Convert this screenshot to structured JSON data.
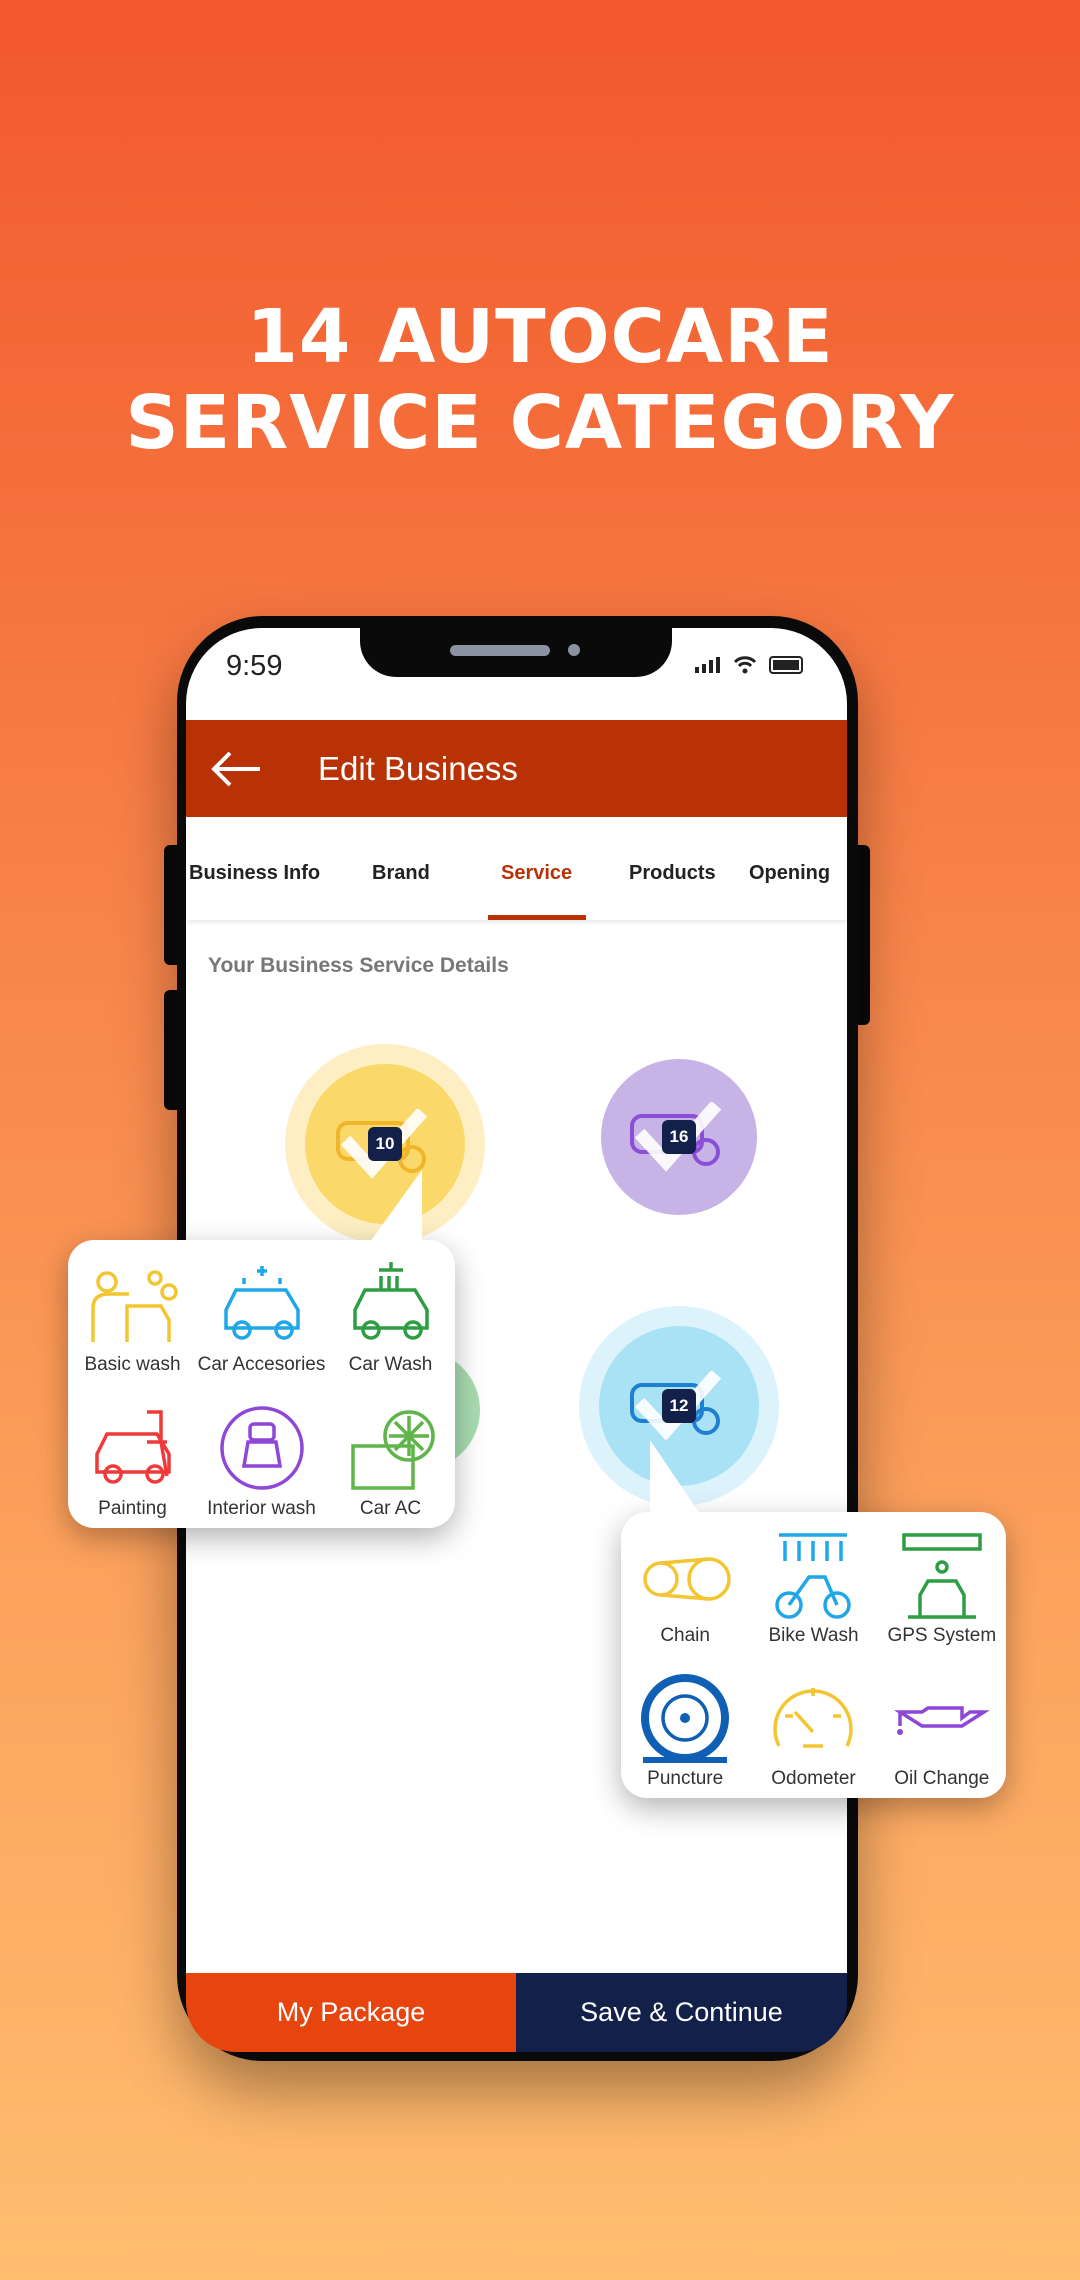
{
  "headline": {
    "line1": "14 AUTOCARE",
    "line2": "SERVICE CATEGORY"
  },
  "status_bar": {
    "time": "9:59",
    "icons": [
      "signal-icon",
      "wifi-icon",
      "battery-icon"
    ]
  },
  "header": {
    "title": "Edit Business",
    "back_icon": "arrow-left-icon"
  },
  "tabs": [
    {
      "label": "Business Info"
    },
    {
      "label": "Brand"
    },
    {
      "label": "Service",
      "active": true
    },
    {
      "label": "Products"
    },
    {
      "label": "Opening"
    }
  ],
  "section_title": "Your Business Service Details",
  "categories": [
    {
      "icon": "car-icon",
      "badge": "10",
      "color": "#fbd86a"
    },
    {
      "icon": "truck-icon",
      "badge": "16",
      "color": "#c8b3e6"
    },
    {
      "icon": "motorbike-icon",
      "badge": "12",
      "color": "#a9e2f5"
    },
    {
      "icon": "green-category-icon",
      "color": "#a9dcb0"
    }
  ],
  "popup_car": [
    {
      "label": "Basic wash",
      "icon": "person-washing-car-icon",
      "color": "#f3c531"
    },
    {
      "label": "Car Accesories",
      "icon": "sparkling-car-icon",
      "color": "#1fa7e8"
    },
    {
      "label": "Car Wash",
      "icon": "shower-car-icon",
      "color": "#2e9e44"
    },
    {
      "label": "Painting",
      "icon": "spray-gun-car-icon",
      "color": "#ee3a3a"
    },
    {
      "label": "Interior wash",
      "icon": "car-seat-icon",
      "color": "#8e47d6"
    },
    {
      "label": "Car AC",
      "icon": "snowflake-ac-icon",
      "color": "#5fb54a"
    }
  ],
  "popup_bike": [
    {
      "label": "Chain",
      "icon": "chain-icon",
      "color": "#f3c531"
    },
    {
      "label": "Bike Wash",
      "icon": "bike-shower-icon",
      "color": "#1fa7e8"
    },
    {
      "label": "GPS System",
      "icon": "gps-car-icon",
      "color": "#2e9e44"
    },
    {
      "label": "Puncture",
      "icon": "tyre-icon",
      "color": "#0f5fb5"
    },
    {
      "label": "Odometer",
      "icon": "speedometer-icon",
      "color": "#f3c531"
    },
    {
      "label": "Oil Change",
      "icon": "oil-can-icon",
      "color": "#8e47d6"
    }
  ],
  "buttons": {
    "my_package": "My Package",
    "save_continue": "Save & Continue"
  },
  "colors": {
    "header": "#b83206",
    "my_package": "#e8450e",
    "save_continue": "#13204a",
    "badge": "#13204a"
  }
}
